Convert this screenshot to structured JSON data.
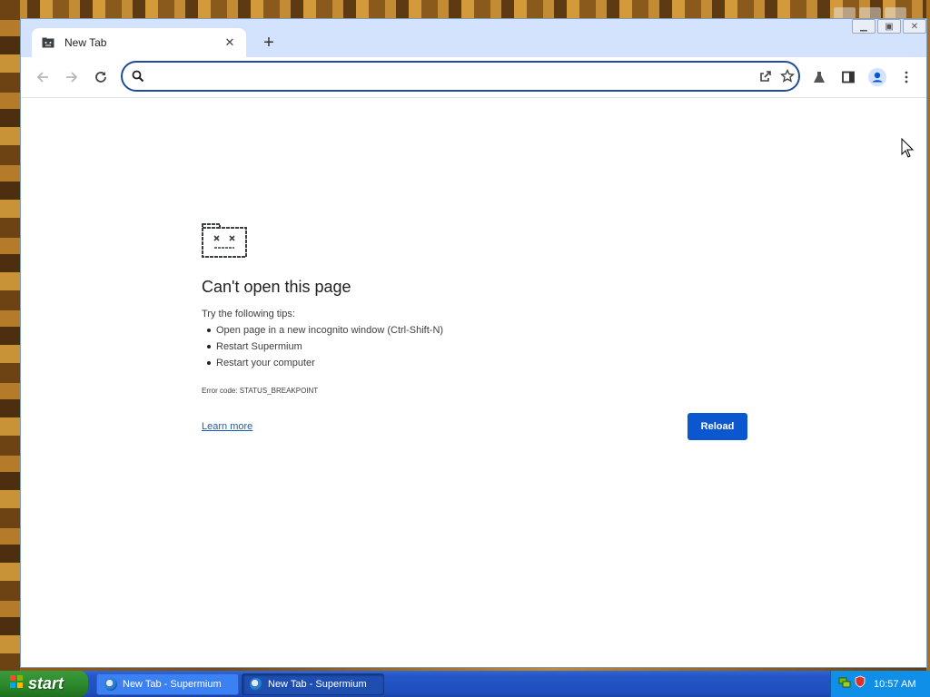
{
  "window": {
    "tab_title": "New Tab",
    "new_tab_symbol": "+",
    "tab_close_symbol": "✕"
  },
  "toolbar": {
    "omnibox_value": "",
    "omnibox_placeholder": ""
  },
  "error_page": {
    "title": "Can't open this page",
    "tips_intro": "Try the following tips:",
    "tips": [
      "Open page in a new incognito window (Ctrl-Shift-N)",
      "Restart Supermium",
      "Restart your computer"
    ],
    "error_code": "Error code: STATUS_BREAKPOINT",
    "learn_more": "Learn more",
    "reload": "Reload"
  },
  "taskbar": {
    "start_label": "start",
    "tasks": [
      "New Tab - Supermium",
      "New Tab - Supermium"
    ],
    "clock": "10:57 AM"
  },
  "icons": {
    "tab": "sad-page-icon",
    "back": "arrow-left-icon",
    "forward": "arrow-right-icon",
    "reload": "reload-icon",
    "search": "search-icon",
    "share": "share-icon",
    "bookmark": "star-icon",
    "labs": "flask-icon",
    "sidepanel": "side-panel-icon",
    "profile": "profile-icon",
    "menu": "kebab-menu-icon"
  },
  "colors": {
    "accent": "#0b57d0",
    "titlebar": "#d3e3fd",
    "omnibox_border": "#1f4d9a"
  }
}
